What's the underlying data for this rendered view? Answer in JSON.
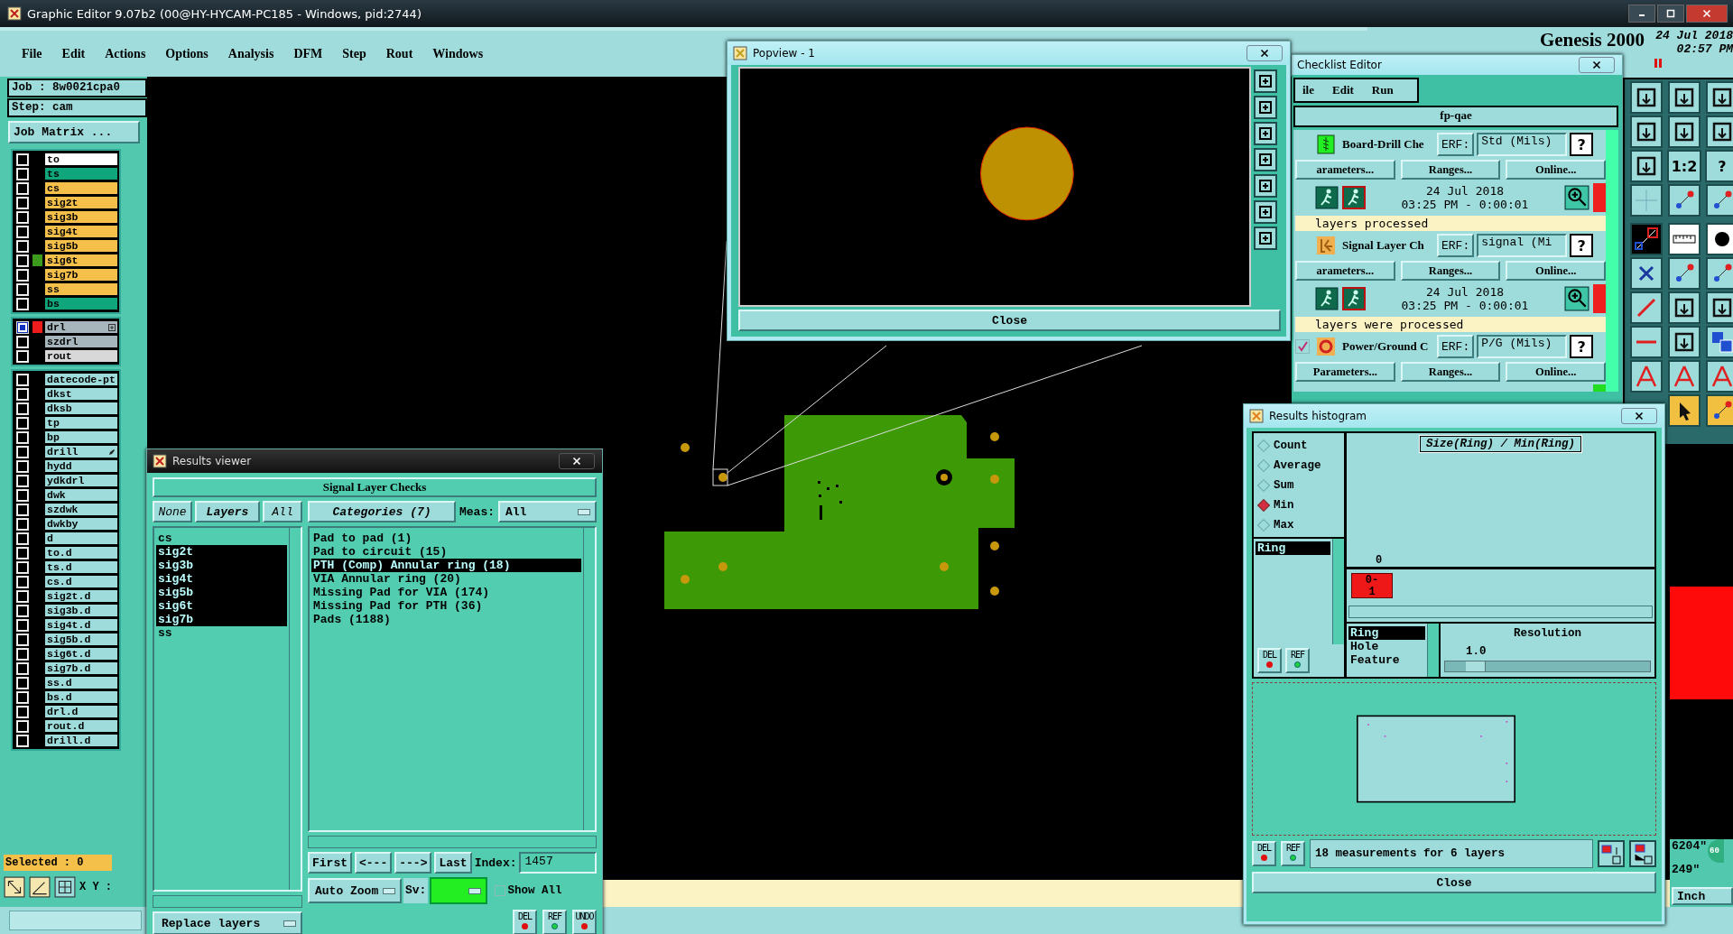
{
  "window": {
    "title": "Graphic Editor 9.07b2 (00@HY-HYCAM-PC185 - Windows, pid:2744)"
  },
  "menu": [
    "File",
    "Edit",
    "Actions",
    "Options",
    "Analysis",
    "DFM",
    "Step",
    "Rout",
    "Windows"
  ],
  "job": "Job : 8w0021cpa0",
  "step": "Step: cam",
  "job_matrix": "Job Matrix ...",
  "layer_groups": [
    [
      {
        "name": "to",
        "color": "#ffffff",
        "checked": false
      },
      {
        "name": "ts",
        "color": "#10a67c",
        "checked": false
      },
      {
        "name": "cs",
        "color": "#f5c04a",
        "checked": false
      },
      {
        "name": "sig2t",
        "color": "#f5c04a",
        "checked": false
      },
      {
        "name": "sig3b",
        "color": "#f5c04a",
        "checked": false
      },
      {
        "name": "sig4t",
        "color": "#f5c04a",
        "checked": false
      },
      {
        "name": "sig5b",
        "color": "#f5c04a",
        "checked": false
      },
      {
        "name": "sig6t",
        "color": "#f5c04a",
        "checked": false,
        "marker": {
          "color": "#3c9a1c"
        }
      },
      {
        "name": "sig7b",
        "color": "#f5c04a",
        "checked": false
      },
      {
        "name": "ss",
        "color": "#f5c04a",
        "checked": false
      },
      {
        "name": "bs",
        "color": "#10a67c",
        "checked": false
      }
    ],
    [
      {
        "name": "drl",
        "color": "#a6b6bc",
        "checked": true,
        "marker": {
          "color": "#ee1c1c"
        },
        "kind": "expandable"
      },
      {
        "name": "szdrl",
        "color": "#a6b6bc",
        "checked": false
      },
      {
        "name": "rout",
        "color": "#d8d8d8",
        "checked": false
      }
    ],
    [
      {
        "name": "datecode-pt",
        "color": "#9edcdc",
        "checked": false
      },
      {
        "name": "dkst",
        "color": "#9edcdc",
        "checked": false
      },
      {
        "name": "dksb",
        "color": "#9edcdc",
        "checked": false
      },
      {
        "name": "tp",
        "color": "#9edcdc",
        "checked": false
      },
      {
        "name": "bp",
        "color": "#9edcdc",
        "checked": false
      },
      {
        "name": "drill",
        "color": "#9edcdc",
        "checked": false,
        "kind": "edited"
      },
      {
        "name": "hydd",
        "color": "#9edcdc",
        "checked": false
      },
      {
        "name": "ydkdrl",
        "color": "#9edcdc",
        "checked": false
      },
      {
        "name": "dwk",
        "color": "#9edcdc",
        "checked": false
      },
      {
        "name": "szdwk",
        "color": "#9edcdc",
        "checked": false
      },
      {
        "name": "dwkby",
        "color": "#9edcdc",
        "checked": false
      },
      {
        "name": "d",
        "color": "#9edcdc",
        "checked": false
      },
      {
        "name": "to.d",
        "color": "#9edcdc",
        "checked": false
      },
      {
        "name": "ts.d",
        "color": "#9edcdc",
        "checked": false
      },
      {
        "name": "cs.d",
        "color": "#9edcdc",
        "checked": false
      },
      {
        "name": "sig2t.d",
        "color": "#9edcdc",
        "checked": false
      },
      {
        "name": "sig3b.d",
        "color": "#9edcdc",
        "checked": false
      },
      {
        "name": "sig4t.d",
        "color": "#9edcdc",
        "checked": false
      },
      {
        "name": "sig5b.d",
        "color": "#9edcdc",
        "checked": false
      },
      {
        "name": "sig6t.d",
        "color": "#9edcdc",
        "checked": false
      },
      {
        "name": "sig7b.d",
        "color": "#9edcdc",
        "checked": false
      },
      {
        "name": "ss.d",
        "color": "#9edcdc",
        "checked": false
      },
      {
        "name": "bs.d",
        "color": "#9edcdc",
        "checked": false
      },
      {
        "name": "drl.d",
        "color": "#9edcdc",
        "checked": false
      },
      {
        "name": "rout.d",
        "color": "#9edcdc",
        "checked": false
      },
      {
        "name": "drill.d",
        "color": "#9edcdc",
        "checked": false
      }
    ]
  ],
  "selected_count": "Selected : 0",
  "xy_label": "X Y :",
  "header": {
    "product": "Genesis 2000",
    "date": "24 Jul 2018",
    "time": "02:57 PM"
  },
  "toolbar_texts": [
    "1:2",
    "?"
  ],
  "popview": {
    "title": "Popview - 1",
    "close": "Close"
  },
  "checklist": {
    "title": "Checklist Editor",
    "menu": [
      "ile",
      "Edit",
      "Run"
    ],
    "name": "fp-qae",
    "actions": [
      {
        "kind": "drill",
        "name": "Board-Drill Che",
        "erf_label": "ERF:",
        "erf": "Std (Mils)",
        "help": "?",
        "buttons": [
          "arameters...",
          "Ranges...",
          "Online..."
        ],
        "date": "24 Jul 2018",
        "time": "03:25 PM - 0:00:01",
        "color": "#ee2020",
        "message": "layers processed"
      },
      {
        "kind": "signal",
        "name": "Signal Layer Ch",
        "erf_label": "ERF:",
        "erf": "signal (Mi",
        "help": "?",
        "buttons": [
          "arameters...",
          "Ranges...",
          "Online..."
        ],
        "date": "24 Jul 2018",
        "time": "03:25 PM - 0:00:01",
        "color": "#ee2020",
        "message": "layers were processed"
      },
      {
        "kind": "power",
        "checked": true,
        "name": "Power/Ground C",
        "erf_label": "ERF:",
        "erf": "P/G (Mils)",
        "help": "?",
        "buttons": [
          "Parameters...",
          "Ranges...",
          "Online..."
        ],
        "color": "#22dd22"
      }
    ]
  },
  "results_viewer": {
    "title": "Results viewer",
    "check": "Signal Layer Checks",
    "layer_buttons": [
      "None",
      "Layers",
      "All"
    ],
    "layers": [
      {
        "name": "cs",
        "selected": false
      },
      {
        "name": "sig2t",
        "selected": true
      },
      {
        "name": "sig3b",
        "selected": true
      },
      {
        "name": "sig4t",
        "selected": true
      },
      {
        "name": "sig5b",
        "selected": true
      },
      {
        "name": "sig6t",
        "selected": true
      },
      {
        "name": "sig7b",
        "selected": true
      },
      {
        "name": "ss",
        "selected": false
      }
    ],
    "categories_label": "Categories (7)",
    "meas_label": "Meas:",
    "meas": "All",
    "categories": [
      {
        "name": "Pad to pad (1)",
        "selected": false
      },
      {
        "name": "Pad to circuit (15)",
        "selected": false
      },
      {
        "name": "PTH (Comp) Annular ring (18)",
        "selected": true
      },
      {
        "name": "VIA Annular ring (20)",
        "selected": false
      },
      {
        "name": "Missing Pad for VIA (174)",
        "selected": false
      },
      {
        "name": "Missing Pad for PTH (36)",
        "selected": false
      },
      {
        "name": "Pads (1188)",
        "selected": false
      }
    ],
    "nav": [
      "First",
      "<---",
      "--->",
      "Last"
    ],
    "index_label": "Index:",
    "index": "1457",
    "zoom": "Auto Zoom",
    "sv_label": "Sv:",
    "severity": {
      "color": "#22ee22"
    },
    "show_all": {
      "label": "Show All",
      "checked": false
    },
    "replace": "Replace layers",
    "actions": [
      "DEL",
      "REF",
      "UNDO"
    ]
  },
  "histogram": {
    "title": "Results histogram",
    "modes": [
      {
        "label": "Count",
        "selected": false
      },
      {
        "label": "Average",
        "selected": false
      },
      {
        "label": "Sum",
        "selected": false
      },
      {
        "label": "Min",
        "selected": true
      },
      {
        "label": "Max",
        "selected": false
      }
    ],
    "attributes": [
      {
        "name": "Ring",
        "selected": true
      }
    ],
    "buttons": [
      "DEL",
      "REF"
    ],
    "chart_title": "Size(Ring) / Min(Ring)",
    "bins": [
      {
        "count": "0",
        "range": "0-1"
      }
    ],
    "fields": [
      {
        "name": "Ring",
        "selected": true
      },
      {
        "name": "Hole",
        "selected": false
      },
      {
        "name": "Feature",
        "selected": false
      }
    ],
    "resolution_label": "Resolution",
    "resolution": "1.0",
    "resolution_slider": {
      "level": 0.1
    },
    "summary_buttons": [
      "DEL",
      "REF"
    ],
    "summary": "18 measurements for 6 layers",
    "close": "Close"
  },
  "coords": {
    "x": "6204\"",
    "y": "249\"",
    "units": "Inch",
    "badge": "60"
  }
}
